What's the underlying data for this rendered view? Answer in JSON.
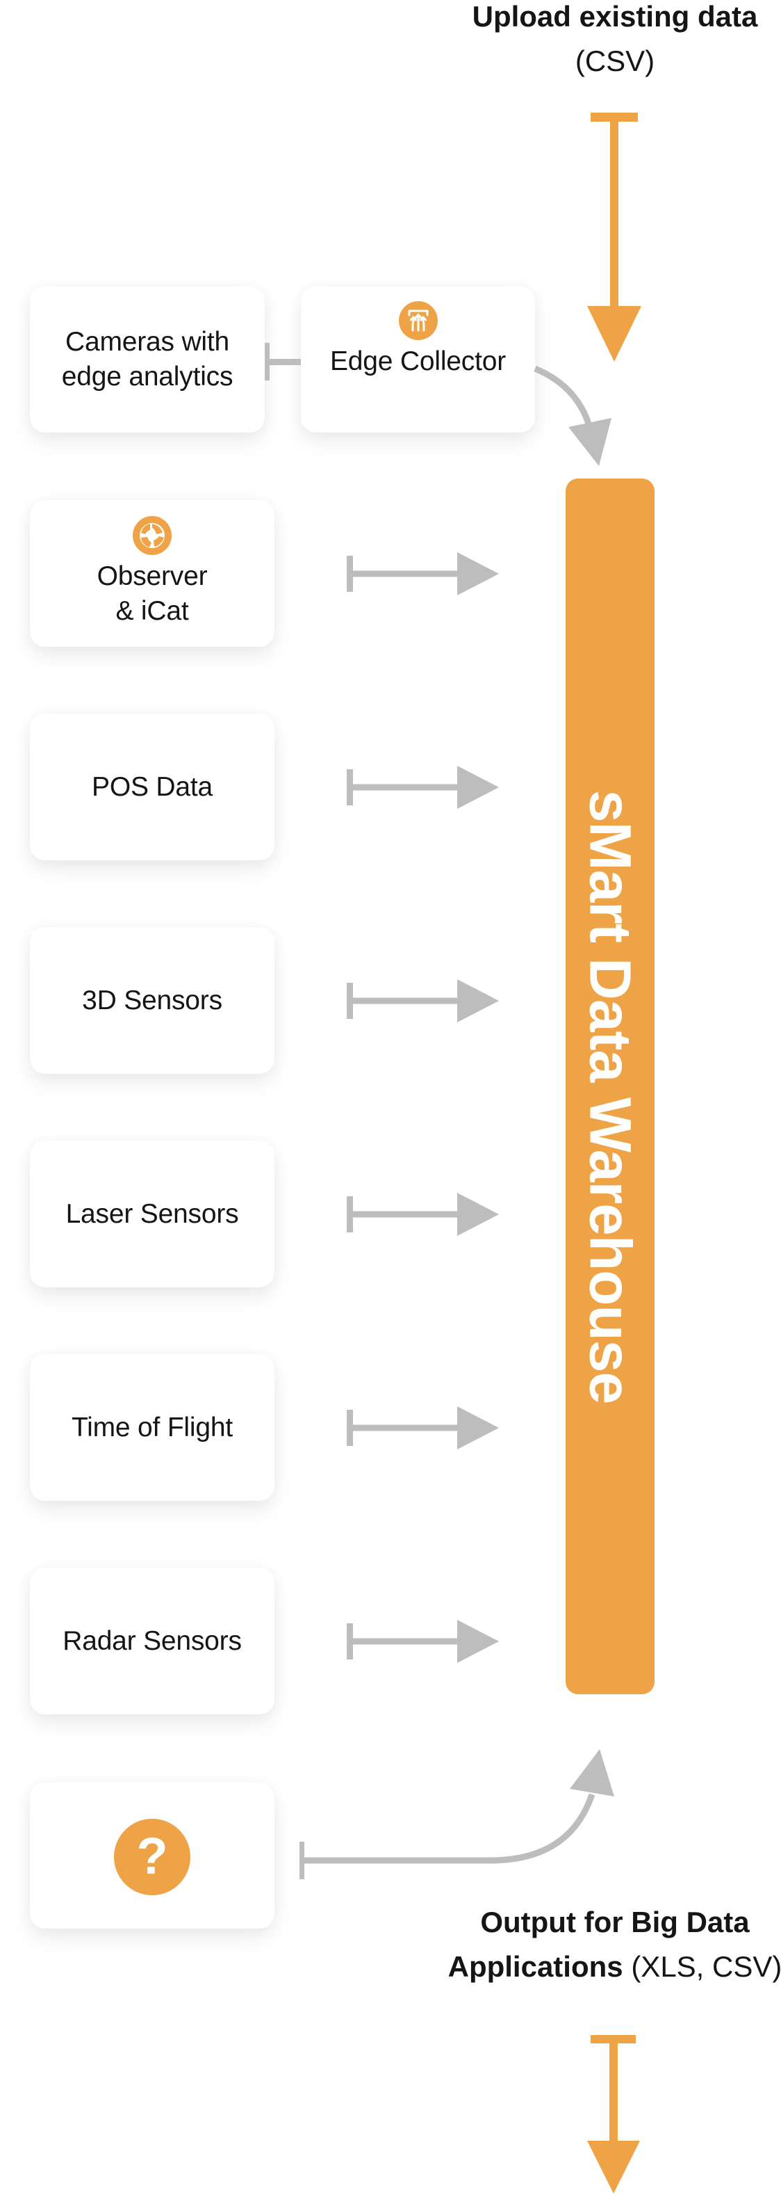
{
  "colors": {
    "accent": "#EFA347",
    "connector": "#BDBDBD",
    "card_bg": "#FFFFFF",
    "text": "#151515"
  },
  "input": {
    "title_bold": "Upload existing data",
    "title_format": "(CSV)",
    "arrow_icon": "arrow-down-icon"
  },
  "warehouse": {
    "title": "sMart Data Warehouse"
  },
  "sources": [
    {
      "label": "Cameras with edge analytics",
      "line1": "Cameras with",
      "line2": "edge analytics",
      "icon": null
    },
    {
      "label": "Edge Collector",
      "icon": "edge-collector-icon"
    },
    {
      "label": "Observer & iCat",
      "line1": "Observer",
      "line2": "& iCat",
      "icon": "observer-aperture-icon"
    },
    {
      "label": "POS Data",
      "icon": null
    },
    {
      "label": "3D Sensors",
      "icon": null
    },
    {
      "label": "Laser Sensors",
      "icon": null
    },
    {
      "label": "Time of Flight",
      "icon": null
    },
    {
      "label": "Radar Sensors",
      "icon": null
    },
    {
      "label": "",
      "icon": "question-mark-icon",
      "glyph": "?"
    }
  ],
  "output": {
    "line1": "Output for Big Data",
    "line2_bold": "Applications",
    "line2_format": "(XLS, CSV)",
    "arrow_icon": "arrow-down-icon"
  }
}
